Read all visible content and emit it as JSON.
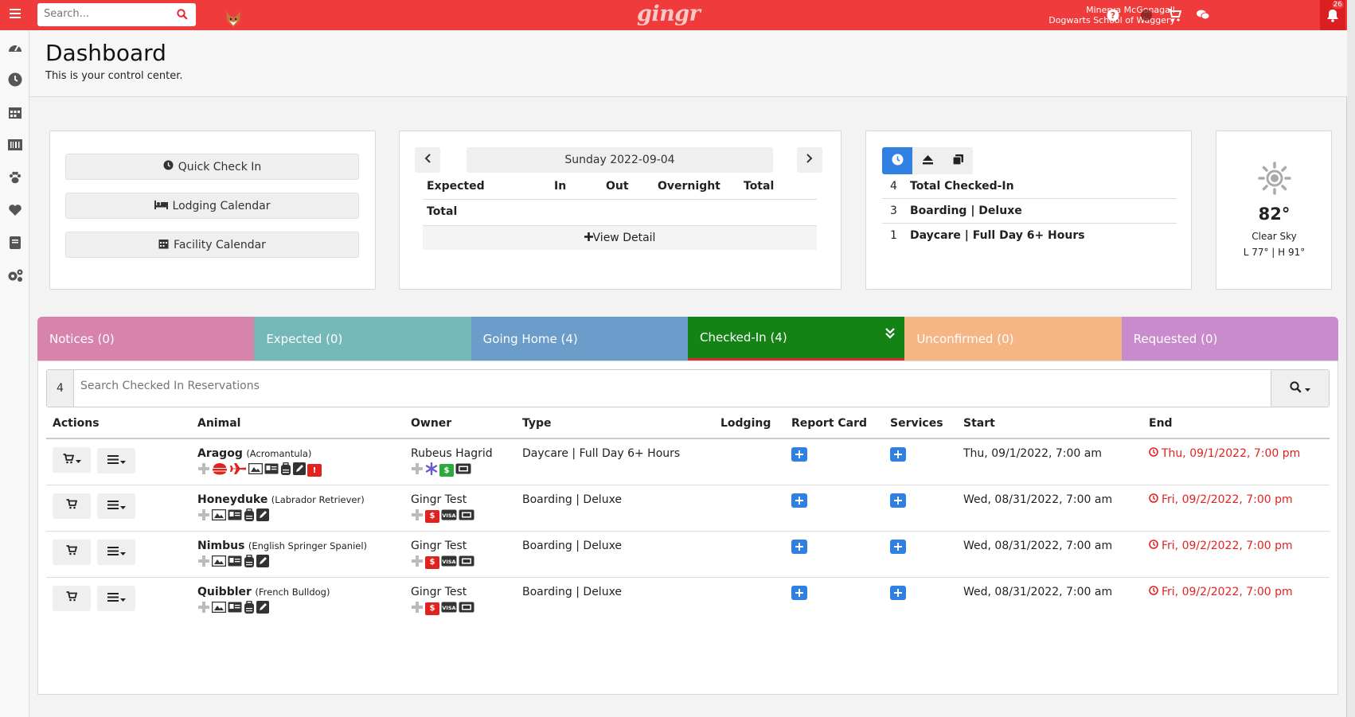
{
  "topbar": {
    "search_placeholder": "Search...",
    "logo": "gingr",
    "user_name": "Minerva McGonagall",
    "user_org": "Dogwarts School of Waggery",
    "notification_count": "26",
    "brand_color": "#ef3b3b"
  },
  "sidebar": {
    "icons": [
      "dashboard-icon",
      "clock-icon",
      "calendar-icon",
      "barcode-icon",
      "paw-icon",
      "heart-icon",
      "book-icon",
      "gears-icon"
    ]
  },
  "header": {
    "title": "Dashboard",
    "subtitle": "This is your control center."
  },
  "quick_actions": {
    "check_in": "Quick Check In",
    "lodging_calendar": "Lodging Calendar",
    "facility_calendar": "Facility Calendar"
  },
  "day_summary": {
    "date": "Sunday 2022-09-04",
    "columns": [
      "Expected",
      "In",
      "Out",
      "Overnight",
      "Total"
    ],
    "total_label": "Total",
    "view_detail": "View Detail"
  },
  "checked_in_summary": {
    "rows": [
      {
        "count": "4",
        "label": "Total Checked-In"
      },
      {
        "count": "3",
        "label": "Boarding | Deluxe"
      },
      {
        "count": "1",
        "label": "Daycare | Full Day 6+ Hours"
      }
    ]
  },
  "weather": {
    "temp": "82°",
    "description": "Clear Sky",
    "range": "L 77° | H 91°"
  },
  "tabs": [
    {
      "label": "Notices (0)",
      "color": "#d883ac"
    },
    {
      "label": "Expected (0)",
      "color": "#74b8b8"
    },
    {
      "label": "Going Home (4)",
      "color": "#6b9cca"
    },
    {
      "label": "Checked-In (4)",
      "color": "#148214"
    },
    {
      "label": "Unconfirmed (0)",
      "color": "#f5b584"
    },
    {
      "label": "Requested (0)",
      "color": "#c98bcb"
    }
  ],
  "reservations": {
    "count": "4",
    "search_placeholder": "Search Checked In Reservations",
    "columns": [
      "Actions",
      "Animal",
      "Owner",
      "Type",
      "Lodging",
      "Report Card",
      "Services",
      "Start",
      "End"
    ],
    "rows": [
      {
        "animal": "Aragog",
        "breed": "(Acromantula)",
        "owner": "Rubeus Hagrid",
        "type": "Daycare | Full Day 6+ Hours",
        "lodging": "",
        "start": "Thu, 09/1/2022, 7:00 am",
        "end": "Thu, 09/1/2022, 7:00 pm"
      },
      {
        "animal": "Honeyduke",
        "breed": "(Labrador Retriever)",
        "owner": "Gingr Test",
        "type": "Boarding | Deluxe",
        "lodging": "",
        "start": "Wed, 08/31/2022, 7:00 am",
        "end": "Fri, 09/2/2022, 7:00 pm"
      },
      {
        "animal": "Nimbus",
        "breed": "(English Springer Spaniel)",
        "owner": "Gingr Test",
        "type": "Boarding | Deluxe",
        "lodging": "",
        "start": "Wed, 08/31/2022, 7:00 am",
        "end": "Fri, 09/2/2022, 7:00 pm"
      },
      {
        "animal": "Quibbler",
        "breed": "(French Bulldog)",
        "owner": "Gingr Test",
        "type": "Boarding | Deluxe",
        "lodging": "",
        "start": "Wed, 08/31/2022, 7:00 am",
        "end": "Fri, 09/2/2022, 7:00 pm"
      }
    ]
  }
}
